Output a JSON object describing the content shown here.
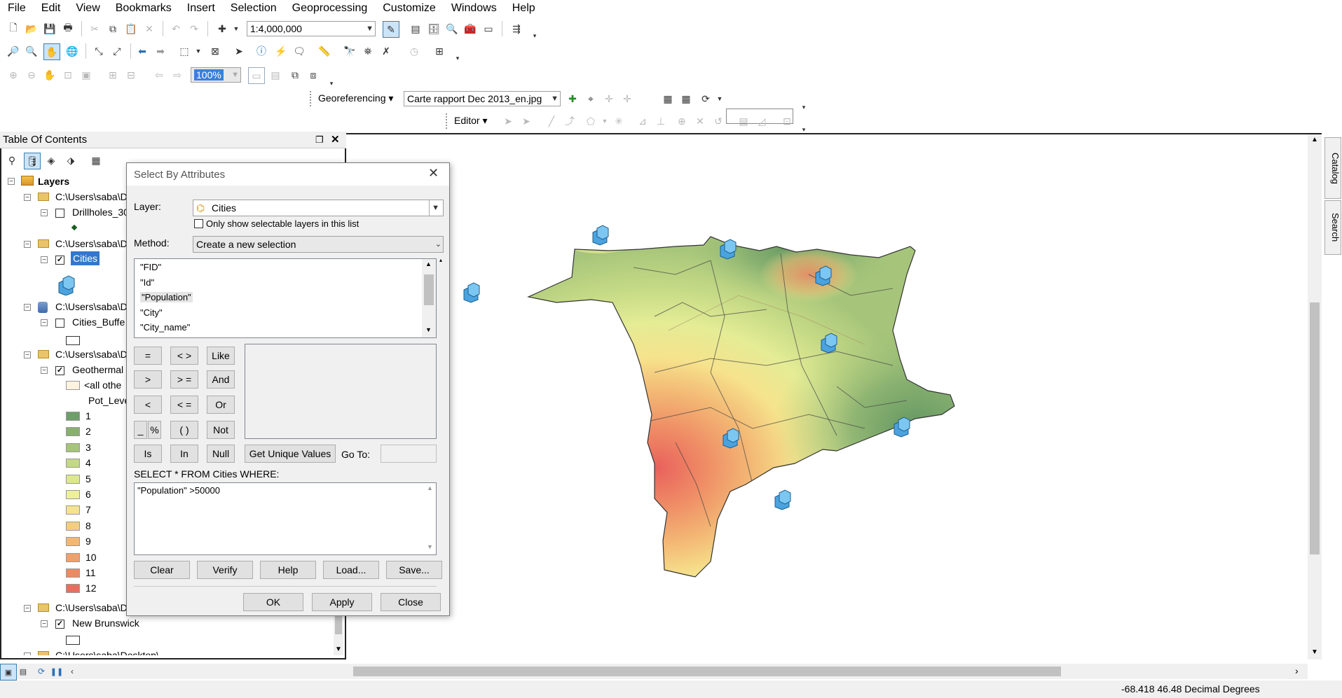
{
  "menu": [
    "File",
    "Edit",
    "View",
    "Bookmarks",
    "Insert",
    "Selection",
    "Geoprocessing",
    "Customize",
    "Windows",
    "Help"
  ],
  "toolbar": {
    "scale": "1:4,000,000",
    "zoom_percent": "100%",
    "georef_label": "Georeferencing ▾",
    "georef_layer": "Carte rapport Dec 2013_en.jpg",
    "editor_label": "Editor ▾"
  },
  "toc": {
    "title": "Table Of Contents",
    "root": "Layers",
    "groups": [
      {
        "path": "C:\\Users\\saba\\D",
        "layer": "Drillholes_30",
        "checked": false
      },
      {
        "path": "C:\\Users\\saba\\D",
        "layer": "Cities",
        "checked": true
      },
      {
        "path": "C:\\Users\\saba\\D",
        "layer": "Cities_Buffe",
        "checked": false
      },
      {
        "path": "C:\\Users\\saba\\D",
        "layer": "Geothermal",
        "checked": true
      },
      {
        "path": "C:\\Users\\saba\\D",
        "layer": "New Brunswick",
        "checked": true
      },
      {
        "path": "C:\\Users\\saba\\Desktop\\",
        "layer": "",
        "checked": false
      }
    ],
    "legend_other": "<all othe",
    "legend_field": "Pot_Leve",
    "legend": [
      {
        "label": "1",
        "color": "#6e9e6a"
      },
      {
        "label": "2",
        "color": "#89b070"
      },
      {
        "label": "3",
        "color": "#a6c57a"
      },
      {
        "label": "4",
        "color": "#c4d985"
      },
      {
        "label": "5",
        "color": "#dde88e"
      },
      {
        "label": "6",
        "color": "#eef09a"
      },
      {
        "label": "7",
        "color": "#f6e38d"
      },
      {
        "label": "8",
        "color": "#f5cd7f"
      },
      {
        "label": "9",
        "color": "#f3b774"
      },
      {
        "label": "10",
        "color": "#f0a06a"
      },
      {
        "label": "11",
        "color": "#ec8a64"
      },
      {
        "label": "12",
        "color": "#e66f60"
      }
    ]
  },
  "dialog": {
    "title": "Select By Attributes",
    "layer_label": "Layer:",
    "layer_value": "Cities",
    "only_selectable": "Only show selectable layers in this list",
    "method_label": "Method:",
    "method_value": "Create a new selection",
    "fields": [
      "\"FID\"",
      "\"Id\"",
      "\"Population\"",
      "\"City\"",
      "\"City_name\""
    ],
    "operators": [
      "=",
      "< >",
      "Like",
      ">",
      "> =",
      "And",
      "<",
      "< =",
      "Or",
      "_",
      "%",
      "( )",
      "Not",
      "Is",
      "In",
      "Null"
    ],
    "get_unique": "Get Unique Values",
    "goto_label": "Go To:",
    "sql_label": "SELECT * FROM Cities WHERE:",
    "expression": "\"Population\" >50000",
    "buttons_row1": [
      "Clear",
      "Verify",
      "Help",
      "Load...",
      "Save..."
    ],
    "buttons_row2": [
      "OK",
      "Apply",
      "Close"
    ]
  },
  "side_tabs": [
    "Catalog",
    "Search"
  ],
  "status": {
    "coords": "-68.418  46.48 Decimal Degrees"
  }
}
